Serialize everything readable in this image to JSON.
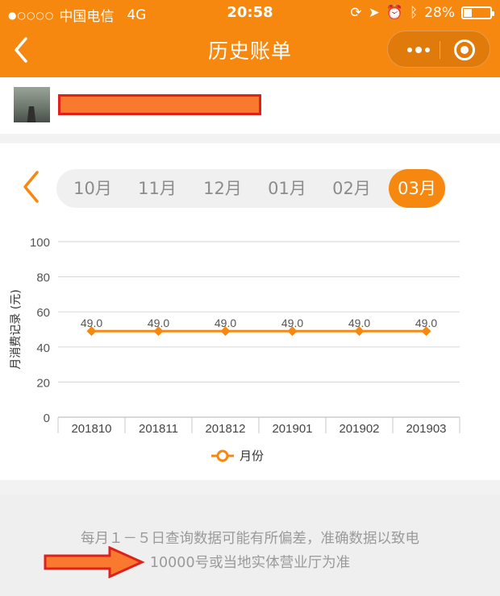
{
  "status_bar": {
    "carrier": "中国电信",
    "network": "4G",
    "time": "20:58",
    "battery": "28%",
    "battery_level": 0.28
  },
  "nav": {
    "title": "历史账单"
  },
  "months": {
    "tabs": [
      "10月",
      "11月",
      "12月",
      "01月",
      "02月",
      "03月"
    ],
    "selected": "03月"
  },
  "chart_data": {
    "type": "line",
    "categories": [
      "201810",
      "201811",
      "201812",
      "201901",
      "201902",
      "201903"
    ],
    "series": [
      {
        "name": "月份",
        "values": [
          49.0,
          49.0,
          49.0,
          49.0,
          49.0,
          49.0
        ],
        "labels": [
          "49.0",
          "49.0",
          "49.0",
          "49.0",
          "49.0",
          "49.0"
        ]
      }
    ],
    "ylabel": "月消费记录 (元)",
    "ylim": [
      0,
      100
    ],
    "yticks": [
      "0",
      "20",
      "40",
      "60",
      "80",
      "100"
    ],
    "grid": true,
    "legend": "bottom",
    "color": "#f7880f"
  },
  "notice": {
    "line1": "每月１－５日查询数据可能有所偏差，准确数据以致电",
    "line2": "10000号或当地实体营业厅为准"
  },
  "colors": {
    "accent": "#f7880f",
    "annotation_red": "#e0201a"
  }
}
